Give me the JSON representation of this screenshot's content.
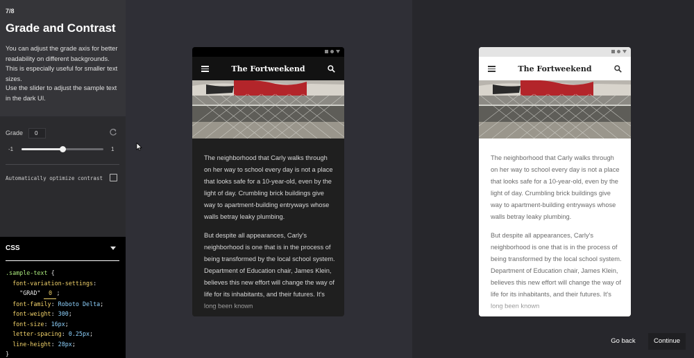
{
  "sidebar": {
    "step": "7/8",
    "title": "Grade and Contrast",
    "description_1": "You can adjust the grade axis for better readability on different backgrounds. This is especially useful for smaller text sizes.",
    "description_2": "Use the slider to adjust the sample text in the dark UI.",
    "grade": {
      "label": "Grade",
      "value": "0",
      "min_label": "-1",
      "max_label": "1",
      "slider_fraction": 0.5
    },
    "auto_contrast": {
      "label": "Automatically optimize contrast",
      "checked": false
    }
  },
  "css_panel": {
    "title": "CSS",
    "selector": ".sample-text",
    "open_brace": "{",
    "close_brace": "}",
    "lines": [
      {
        "prop": "font-variation-settings",
        "value": ""
      },
      {
        "prop": "font-family",
        "value": "Roboto Delta"
      },
      {
        "prop": "font-weight",
        "value": "300"
      },
      {
        "prop": "font-size",
        "value": "16px"
      },
      {
        "prop": "letter-spacing",
        "value": "0.25px"
      },
      {
        "prop": "line-height",
        "value": "28px"
      }
    ],
    "grad_string": "\"GRAD\"",
    "grad_value": "0"
  },
  "phones": {
    "app_title": "The Fortweekend",
    "paragraph_1": "The neighborhood that Carly walks through on her way to school every day is not a place that looks safe for a 10-year-old, even by the light of day. Crumbling brick buildings give way to apartment-building entryways whose walls betray leaky plumbing.",
    "paragraph_2": "But despite all appearances, Carly's neighborhood is one that is in the process of being transformed by the local school system. Department of Education chair, James Klein, believes this new effort will change the way of life for its inhabitants, and their futures. It's long been known"
  },
  "footer": {
    "go_back": "Go back",
    "continue": "Continue"
  },
  "colors": {
    "code_selector": "#a8e67a",
    "code_property": "#f2d36b",
    "code_value": "#8fd3ff"
  }
}
